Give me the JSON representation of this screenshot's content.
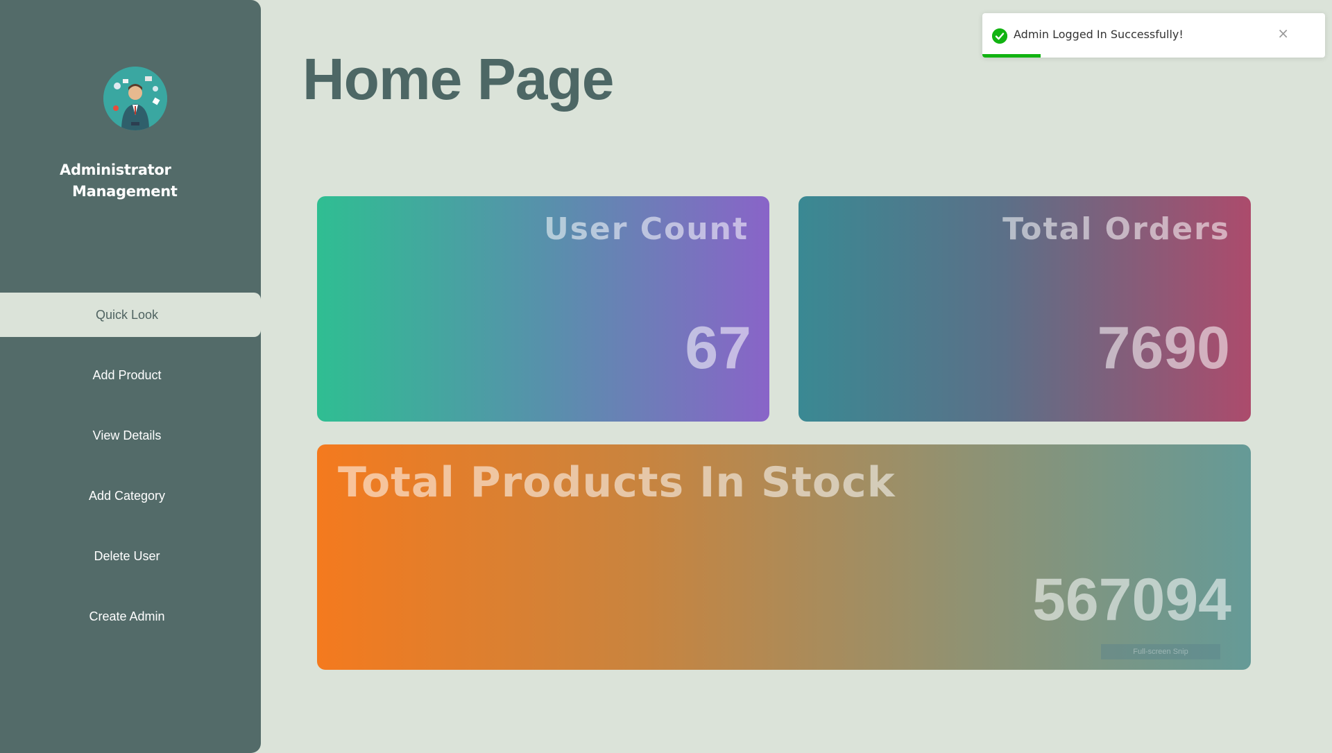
{
  "sidebar": {
    "avatar_icon": "admin-avatar-icon",
    "brand_line1": "Administrator",
    "brand_line2": "Management",
    "items": [
      {
        "label": "Quick Look",
        "active": true
      },
      {
        "label": "Add Product",
        "active": false
      },
      {
        "label": "View Details",
        "active": false
      },
      {
        "label": "Add Category",
        "active": false
      },
      {
        "label": "Delete User",
        "active": false
      },
      {
        "label": "Create Admin",
        "active": false
      }
    ]
  },
  "main": {
    "title": "Home Page",
    "cards": {
      "users": {
        "title": "User Count",
        "value": "67"
      },
      "orders": {
        "title": "Total Orders",
        "value": "7690"
      },
      "stock": {
        "title": "Total Products In Stock",
        "value": "567094",
        "snip_label": "Full-screen Snip"
      }
    }
  },
  "toast": {
    "message": "Admin Logged In Successfully!",
    "close_symbol": "×",
    "icon": "check-circle-icon",
    "progress_fraction": 0.17,
    "color": "#12b312"
  }
}
